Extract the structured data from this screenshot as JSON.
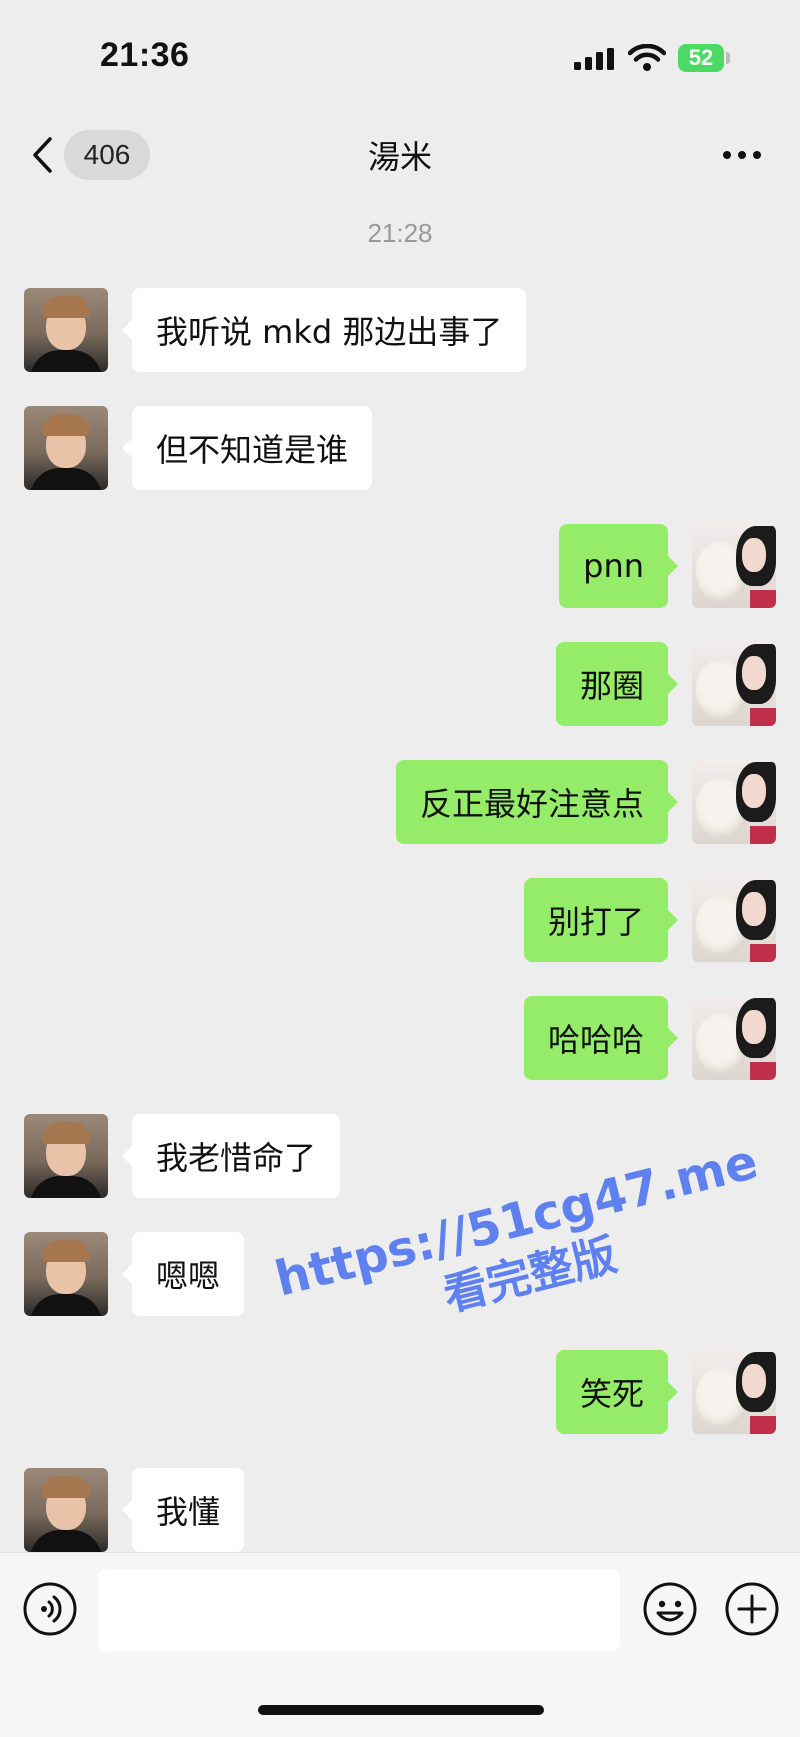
{
  "status_bar": {
    "time": "21:36",
    "battery": "52",
    "icons": [
      "signal-icon",
      "wifi-icon",
      "battery-charging-icon"
    ]
  },
  "nav": {
    "unread_count": "406",
    "title": "湯米",
    "icons": [
      "back-chevron-icon",
      "more-icon"
    ]
  },
  "timestamp": "21:28",
  "messages": [
    {
      "side": "in",
      "text": "我听说 mkd 那边出事了"
    },
    {
      "side": "in",
      "text": "但不知道是谁"
    },
    {
      "side": "out",
      "text": "pnn"
    },
    {
      "side": "out",
      "text": "那圈"
    },
    {
      "side": "out",
      "text": "反正最好注意点"
    },
    {
      "side": "out",
      "text": "别打了"
    },
    {
      "side": "out",
      "text": "哈哈哈"
    },
    {
      "side": "in",
      "text": "我老惜命了"
    },
    {
      "side": "in",
      "text": "嗯嗯"
    },
    {
      "side": "out",
      "text": "笑死"
    },
    {
      "side": "in",
      "text": "我懂"
    }
  ],
  "watermark": {
    "line1": "https://51cg47.me",
    "line2": "看完整版"
  },
  "input_bar": {
    "value": "",
    "icons": [
      "voice-icon",
      "emoji-icon",
      "plus-icon"
    ]
  },
  "colors": {
    "background": "#ededed",
    "incoming_bubble": "#ffffff",
    "outgoing_bubble": "#95ec69",
    "battery": "#4cd964",
    "watermark": "#4f76f0"
  }
}
